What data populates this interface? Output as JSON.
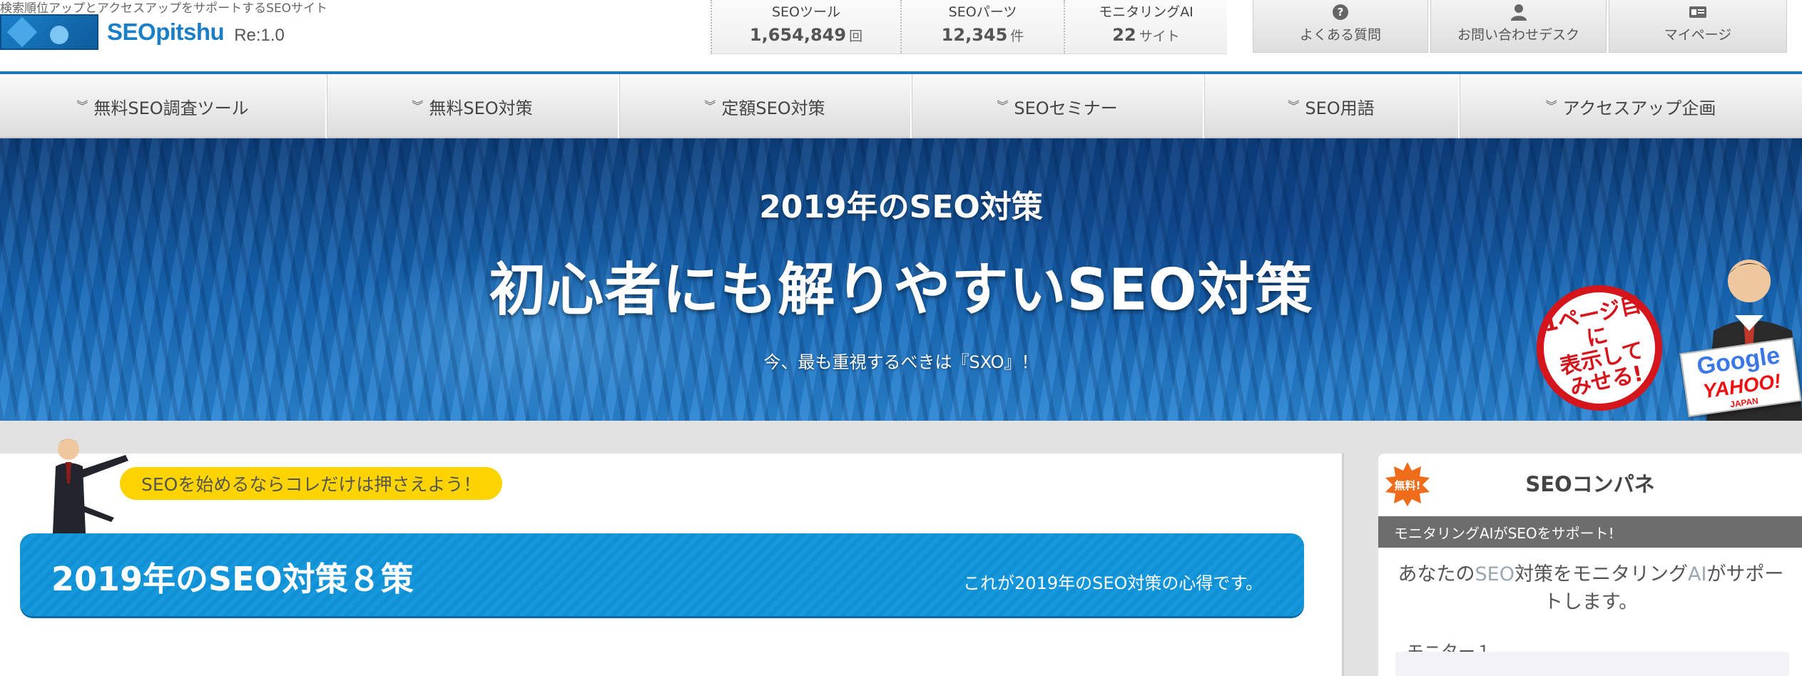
{
  "header": {
    "tagline": "検索順位アップとアクセスアップをサポートするSEOサイト",
    "logo_text": "SEOpitshu",
    "logo_version": "Re:1.0",
    "stats": [
      {
        "label": "SEOツール",
        "value": "1,654,849",
        "unit": "回"
      },
      {
        "label": "SEOパーツ",
        "value": "12,345",
        "unit": "件"
      },
      {
        "label": "モニタリングAI",
        "value": "22",
        "unit": "サイト"
      }
    ],
    "buttons": [
      {
        "label": "よくある質問",
        "icon": "question-icon"
      },
      {
        "label": "お問い合わせデスク",
        "icon": "user-icon"
      },
      {
        "label": "マイページ",
        "icon": "id-card-icon"
      }
    ]
  },
  "nav": {
    "items": [
      {
        "label": "無料SEO調査ツール"
      },
      {
        "label": "無料SEO対策"
      },
      {
        "label": "定額SEO対策"
      },
      {
        "label": "SEOセミナー"
      },
      {
        "label": "SEO用語"
      },
      {
        "label": "アクセスアップ企画"
      }
    ]
  },
  "hero": {
    "subtitle": "2019年のSEO対策",
    "title": "初心者にも解りやすいSEO対策",
    "note": "今、最も重視するべきは『SXO』！",
    "badge": "1ページ目に\n表示して\nみせる!",
    "brand_google": "Google",
    "brand_yahoo": "YAHOO!",
    "brand_japan": "JAPAN"
  },
  "main": {
    "pill": "SEOを始めるならコレだけは押さえよう！",
    "banner_title": "2019年のSEO対策８策",
    "banner_note": "これが2019年のSEO対策の心得です。"
  },
  "sidebar": {
    "free_badge": "無料!",
    "title": "SEOコンパネ",
    "bar": "モニタリングAIがSEOをサポート!",
    "text_a": "あなたの",
    "text_hl1": "SEO",
    "text_b": "対策をモニタリング",
    "text_hl2": "AI",
    "text_c": "がサポートします。",
    "monitor_label": "モニター１"
  },
  "colors": {
    "accent": "#1e78b8",
    "banner": "#1598dc",
    "pill": "#fdd400",
    "badge_red": "#d4151c"
  }
}
